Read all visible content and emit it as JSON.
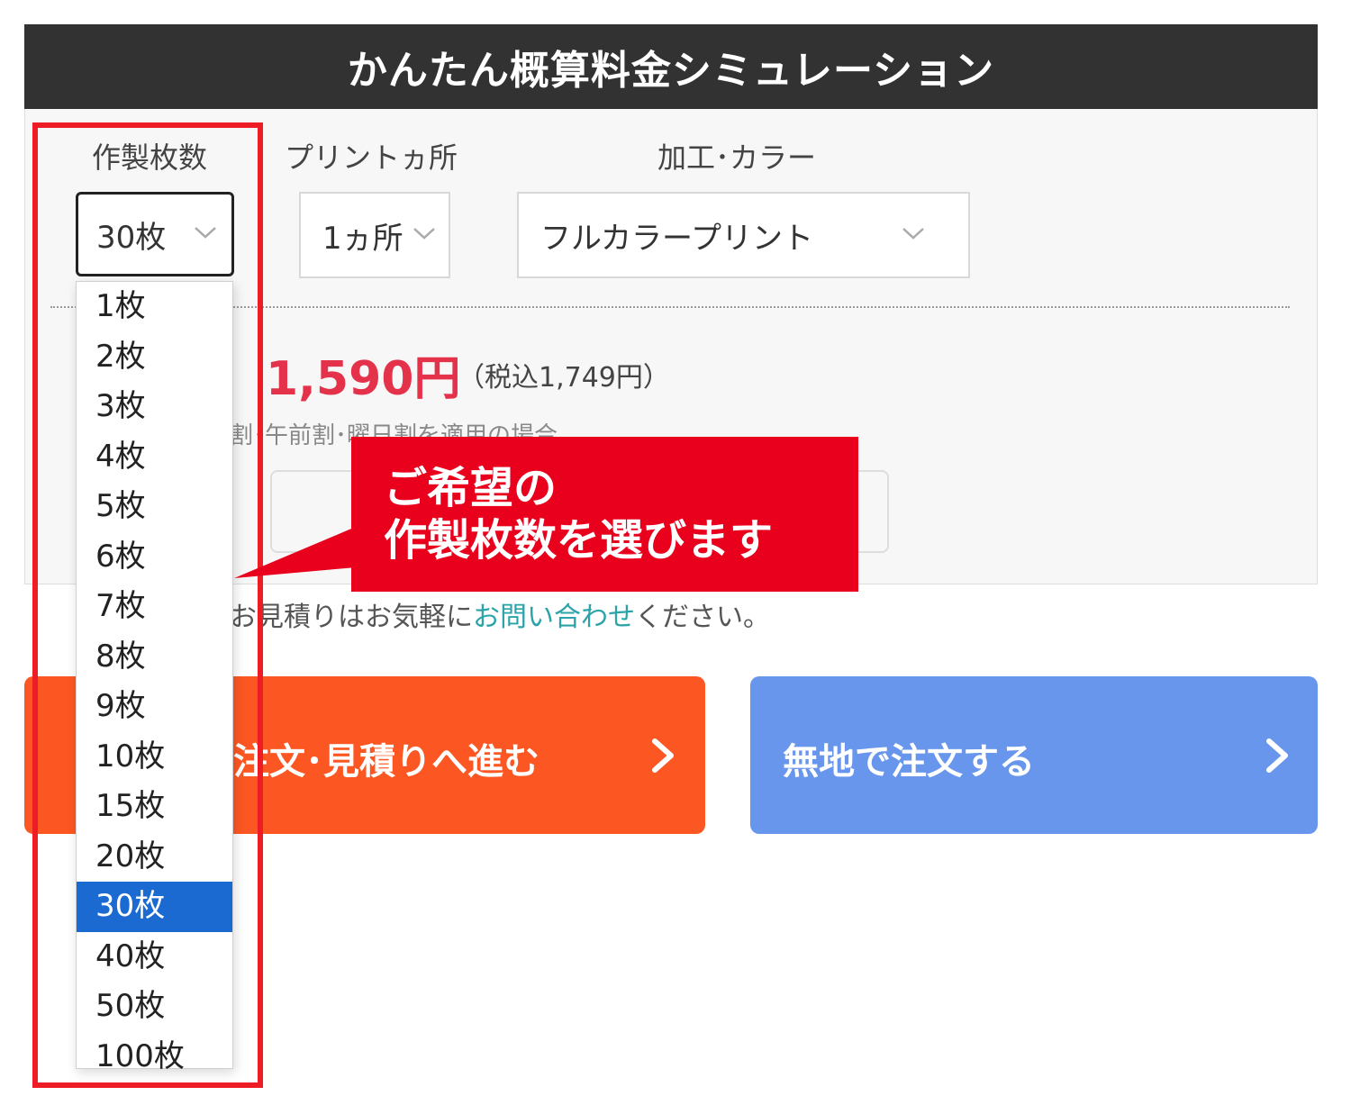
{
  "header": {
    "title": "かんたん概算料金シミュレーション"
  },
  "labels": {
    "quantity": "作製枚数",
    "print_location": "プリントヵ所",
    "processing_color": "加工･カラー"
  },
  "selects": {
    "quantity": "30枚",
    "print_location": "1ヵ所",
    "processing_color": "フルカラープリント"
  },
  "price": {
    "amount": "1,590円",
    "tax_included": "（税込1,749円）",
    "discount_note": "割･午前割･曜日割を適用の場合"
  },
  "note": {
    "prefix": "お見積りはお気軽に",
    "link": "お問い合わせ",
    "suffix": "ください。"
  },
  "buttons": {
    "order": "注文･見積りへ進む",
    "plain_order": "無地で注文する"
  },
  "dropdown": {
    "options": [
      "1枚",
      "2枚",
      "3枚",
      "4枚",
      "5枚",
      "6枚",
      "7枚",
      "8枚",
      "9枚",
      "10枚",
      "15枚",
      "20枚",
      "30枚",
      "40枚",
      "50枚",
      "100枚"
    ],
    "selected": "30枚"
  },
  "callout": {
    "line1": "ご希望の",
    "line2": "作製枚数を選びます"
  },
  "colors": {
    "header_bg": "#323232",
    "price_red": "#e4324b",
    "order_button": "#fc5722",
    "plain_button": "#6896ec",
    "selected_option": "#1a6ad2",
    "annotation_red": "#e8001c",
    "link_teal": "#2aa3a9"
  }
}
